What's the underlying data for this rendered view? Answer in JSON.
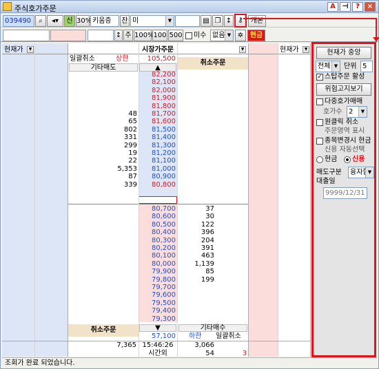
{
  "window": {
    "title": "주식호가주문"
  },
  "toolbar1": {
    "code": "039490",
    "tag_new": "신",
    "pct": "30%",
    "name": "키움증",
    "jan": "잔",
    "mi": "미",
    "up_arrow": "↕",
    "kaebon": "개본"
  },
  "toolbar2": {
    "ju": "주",
    "pct100": "100%",
    "n100": "100",
    "n500": "500",
    "misu": "미수",
    "none": "없음",
    "cash": "현금"
  },
  "grid": {
    "col_left_header": "현재가",
    "col_center_header": "시장가주문",
    "col_right_header": "현재가",
    "bulk_cancel_left": "일괄취소",
    "upper_limit_label": "상한",
    "upper_limit_value": "105,500",
    "cancel_order_top": "취소주문",
    "other_sell": "기타매도",
    "up_marker": "▲",
    "ask_rows": [
      {
        "qty": "",
        "price": "82,200"
      },
      {
        "qty": "",
        "price": "82,100"
      },
      {
        "qty": "",
        "price": "82,000"
      },
      {
        "qty": "",
        "price": "81,900"
      },
      {
        "qty": "",
        "price": "81,800"
      },
      {
        "qty": "48",
        "price": "81,700"
      },
      {
        "qty": "65",
        "price": "81,600"
      },
      {
        "qty": "802",
        "price": "81,500"
      },
      {
        "qty": "331",
        "price": "81,400"
      },
      {
        "qty": "299",
        "price": "81,300"
      },
      {
        "qty": "19",
        "price": "81,200"
      },
      {
        "qty": "22",
        "price": "81,100"
      },
      {
        "qty": "5,353",
        "price": "81,000"
      },
      {
        "qty": "87",
        "price": "80,900"
      },
      {
        "qty": "339",
        "price": "80,800"
      }
    ],
    "bid_rows": [
      {
        "qty": "37",
        "price": "80,700"
      },
      {
        "qty": "30",
        "price": "80,600"
      },
      {
        "qty": "122",
        "price": "80,500"
      },
      {
        "qty": "396",
        "price": "80,400"
      },
      {
        "qty": "204",
        "price": "80,300"
      },
      {
        "qty": "391",
        "price": "80,200"
      },
      {
        "qty": "463",
        "price": "80,100"
      },
      {
        "qty": "1,139",
        "price": "80,000"
      },
      {
        "qty": "85",
        "price": "79,900"
      },
      {
        "qty": "199",
        "price": "79,800"
      },
      {
        "qty": "",
        "price": "79,700"
      },
      {
        "qty": "",
        "price": "79,600"
      },
      {
        "qty": "",
        "price": "79,500"
      },
      {
        "qty": "",
        "price": "79,400"
      },
      {
        "qty": "",
        "price": "79,300"
      }
    ],
    "down_marker": "▼",
    "other_buy": "기타매수",
    "cancel_order_bottom": "취소주문",
    "lower_limit_value": "57,100",
    "lower_limit_label": "하한",
    "bulk_cancel_right": "일괄취소",
    "total_ask": "7,365",
    "time": "15:46:26",
    "total_bid": "3,066",
    "after_hours": "시간외",
    "after_hours_value": "54",
    "after_hours_change": "3"
  },
  "panel": {
    "center_btn": "현재가 중앙",
    "scope": "전체",
    "unit_label": "단위",
    "unit_value": "5",
    "stop_order": "스탑주문 활성",
    "risk_btn": "위험고지보기",
    "multi_order": "다중호가매매",
    "hoga_count_label": "호가수",
    "hoga_count_value": "2",
    "one_click": "원클릭 취소",
    "order_area": "주문영역 표시",
    "change_cash": "종목변경시 현금",
    "credit_auto": "신용 자동선택",
    "radio_cash": "현금",
    "radio_credit": "신용",
    "sell_type_label": "매도구분",
    "sell_type_value": "융자합",
    "loan_date_label": "대출일",
    "loan_date_value": "9999/12/31"
  },
  "status": {
    "message": "조회가 완료 되었습니다."
  },
  "colors": {
    "ask_blue": "#dce6f6",
    "bid_red": "#fbdedc",
    "header_tan": "#f2e3c8",
    "accent_red": "#e0141c"
  }
}
